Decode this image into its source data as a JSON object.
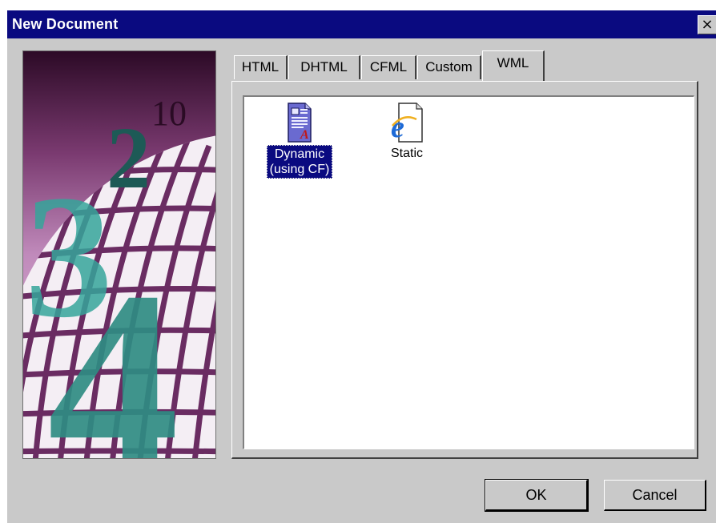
{
  "window": {
    "title": "New Document",
    "close_glyph": "×"
  },
  "art": {
    "numerals": [
      "2",
      "3",
      "4",
      "10"
    ]
  },
  "tabs": [
    {
      "label": "HTML",
      "active": false
    },
    {
      "label": "DHTML",
      "active": false
    },
    {
      "label": "CFML",
      "active": false
    },
    {
      "label": "Custom",
      "active": false
    },
    {
      "label": "WML",
      "active": true
    }
  ],
  "items": [
    {
      "line1": "Dynamic",
      "line2": "(using CF)",
      "icon": "dynamic-document-icon",
      "selected": true
    },
    {
      "line1": "Static",
      "line2": "",
      "icon": "internet-explorer-document-icon",
      "selected": false
    }
  ],
  "buttons": {
    "ok": "OK",
    "cancel": "Cancel"
  },
  "colors": {
    "titlebar": "#0a0a80",
    "face": "#c9c9c9",
    "selection": "#0a0a80",
    "teal": "#2f8c82",
    "purple": "#5c1e52"
  }
}
